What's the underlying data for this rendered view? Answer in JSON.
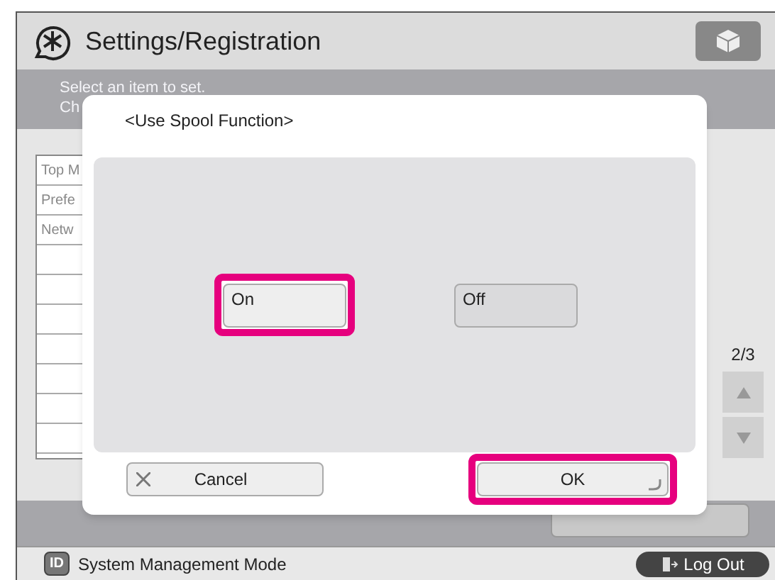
{
  "header": {
    "title": "Settings/Registration"
  },
  "instruction": [
    "Select an item to set.",
    "Ch"
  ],
  "list_items": [
    "Top M",
    "Prefe",
    "Netw"
  ],
  "pager": {
    "page": "2/3"
  },
  "dialog": {
    "title": "<Use Spool Function>",
    "options": [
      {
        "label": "On",
        "selected": true,
        "highlighted": true
      },
      {
        "label": "Off",
        "selected": false,
        "highlighted": false
      }
    ],
    "cancel": {
      "label": "Cancel"
    },
    "ok": {
      "label": "OK",
      "highlighted": true
    }
  },
  "status_bar": {
    "mode": "System Management Mode",
    "id_badge": "ID",
    "logout": "Log Out"
  }
}
